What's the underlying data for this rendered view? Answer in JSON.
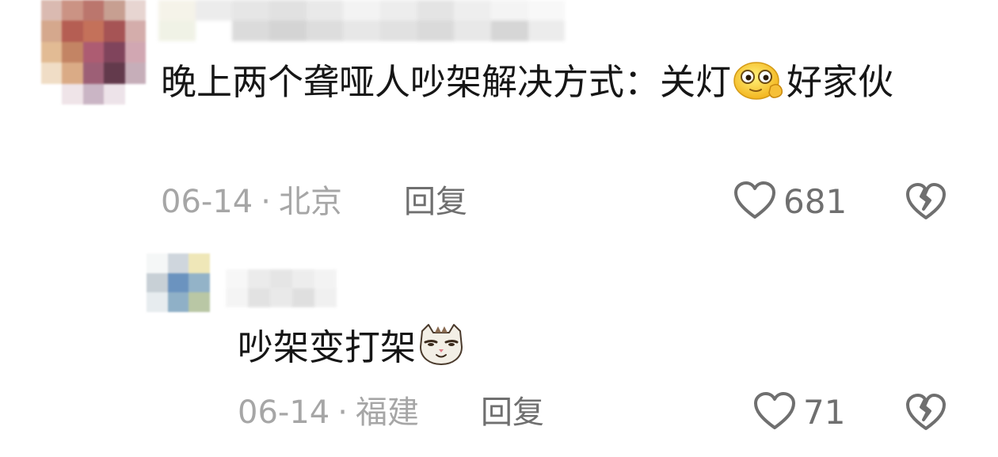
{
  "comments": [
    {
      "text_before_emoji": "晚上两个聋哑人吵架解决方式：关灯",
      "emoji": "thinking-peek-emoji",
      "text_after_emoji": "好家伙",
      "date": "06-14",
      "location": "北京",
      "reply_label": "回复",
      "like_count": "681"
    },
    {
      "text_before_emoji": "吵架变打架",
      "emoji": "smug-cat-emoji",
      "text_after_emoji": "",
      "date": "06-14",
      "location": "福建",
      "reply_label": "回复",
      "like_count": "71"
    }
  ],
  "separator": "·",
  "icons": {
    "like": "heart-outline-icon",
    "dislike": "broken-heart-icon"
  },
  "colors": {
    "text": "#161616",
    "meta": "#a6a6a6",
    "action": "#6f6f6f"
  }
}
